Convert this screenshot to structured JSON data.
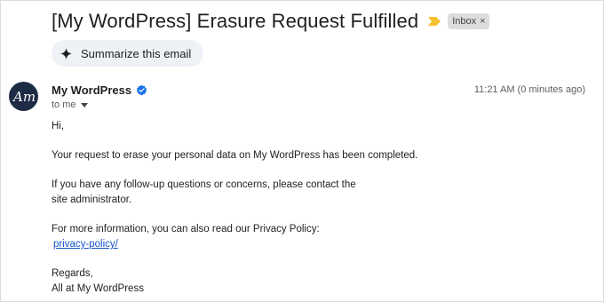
{
  "email": {
    "subject": "[My WordPress] Erasure Request Fulfilled",
    "label": "Inbox",
    "label_remove": "×",
    "summarize_label": "Summarize this email",
    "sender_name": "My WordPress",
    "recipient": "to me",
    "timestamp": "11:21 AM (0 minutes ago)",
    "body": {
      "greeting": "Hi,",
      "line1": "Your request to erase your personal data on My WordPress has been completed.",
      "line2a": "If you have any follow-up questions or concerns, please contact the",
      "line2b": "site administrator.",
      "line3": "For more information, you can also read our Privacy Policy:",
      "link": "privacy-policy/",
      "closing1": "Regards,",
      "closing2": "All at My WordPress"
    }
  },
  "colors": {
    "accent_link": "#1a55c8",
    "avatar_bg": "#1d2b45",
    "importance": "#f2c12e",
    "verified": "#1a73e8"
  },
  "icons": {
    "importance": "importance-marker-icon",
    "summarize": "sparkle-icon",
    "verified": "verified-badge-icon",
    "recipient_toggle": "caret-down-icon",
    "avatar": "am-logo-icon"
  }
}
